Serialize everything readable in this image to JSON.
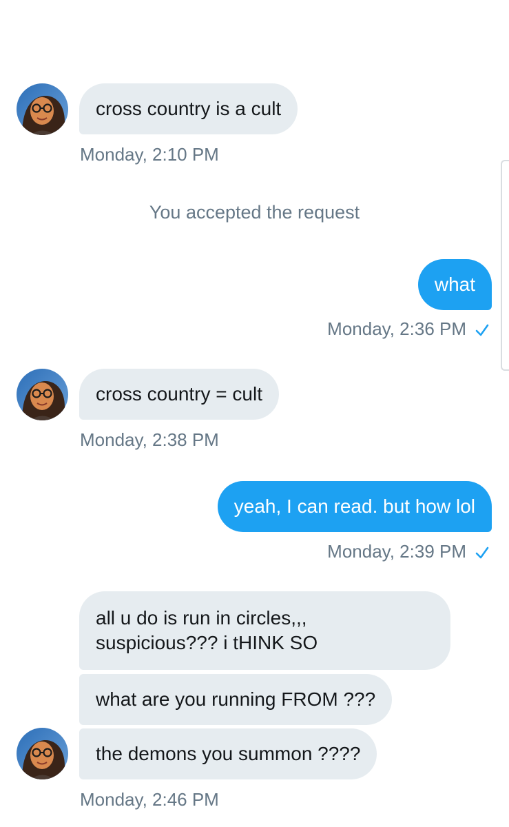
{
  "conversation": {
    "messages": [
      {
        "id": "m1",
        "direction": "received",
        "text": "cross country is a cult",
        "timestamp": "Monday, 2:10 PM"
      },
      {
        "id": "sys1",
        "direction": "system",
        "text": "You accepted the request"
      },
      {
        "id": "m2",
        "direction": "sent",
        "text": "what",
        "timestamp": "Monday, 2:36 PM",
        "status": "read-check-icon"
      },
      {
        "id": "m3",
        "direction": "received",
        "text": "cross country = cult",
        "timestamp": "Monday, 2:38 PM"
      },
      {
        "id": "m4",
        "direction": "sent",
        "text": "yeah, I can read. but how lol",
        "timestamp": "Monday, 2:39 PM",
        "status": "read-check-icon"
      },
      {
        "id": "m5",
        "direction": "received",
        "lines": [
          "all u do is run in circles,,,",
          "suspicious??? i tHINK SO"
        ]
      },
      {
        "id": "m6",
        "direction": "received",
        "text": "what are you running FROM ???"
      },
      {
        "id": "m7",
        "direction": "received",
        "text": "the demons you summon ????",
        "timestamp": "Monday, 2:46 PM"
      }
    ]
  },
  "colors": {
    "sent_bubble": "#1da1f2",
    "received_bubble": "#e6ecf0",
    "timestamp": "#657786",
    "check": "#1da1f2"
  }
}
